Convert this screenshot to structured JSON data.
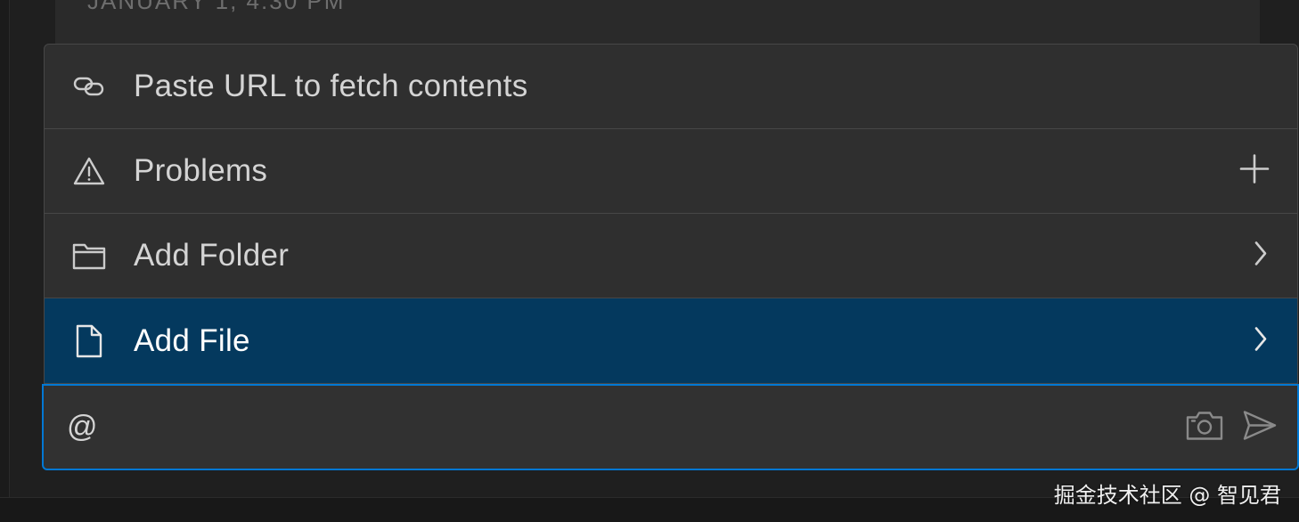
{
  "background_card": {
    "timestamp": "JANUARY 1, 4:30 PM"
  },
  "menu": {
    "items": [
      {
        "label": "Paste URL to fetch contents",
        "icon": "link-icon",
        "trailing": ""
      },
      {
        "label": "Problems",
        "icon": "warning-icon",
        "trailing": "plus-icon"
      },
      {
        "label": "Add Folder",
        "icon": "folder-icon",
        "trailing": "chevron-right-icon"
      },
      {
        "label": "Add File",
        "icon": "file-icon",
        "trailing": "chevron-right-icon",
        "selected": true
      }
    ]
  },
  "input": {
    "value": "@",
    "icons": [
      "camera-icon",
      "send-icon"
    ]
  },
  "watermark": "掘金技术社区 @ 智见君",
  "colors": {
    "selected_background": "#04395e",
    "focus_border": "#0078d4",
    "menu_background": "#2f2f2f"
  }
}
